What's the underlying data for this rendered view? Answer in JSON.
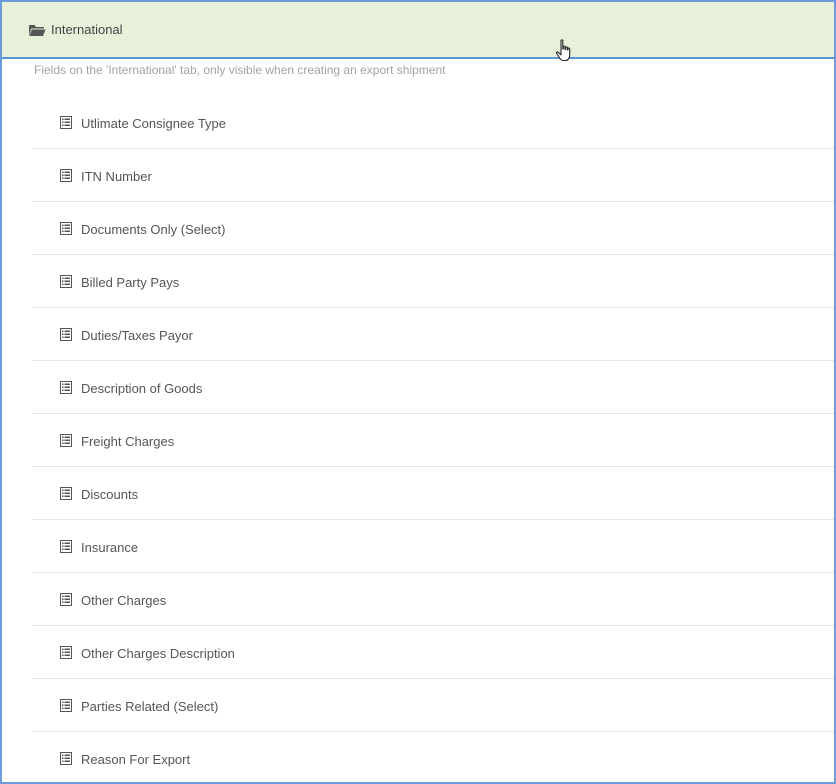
{
  "section": {
    "title": "International",
    "icon": "folder-open-icon",
    "description": "Fields on the 'International' tab, only visible when creating an export shipment",
    "header_color": "#e7f1da",
    "accent_color": "#5b95d6"
  },
  "fields": [
    {
      "label": "Utlimate Consignee Type",
      "icon": "list-icon"
    },
    {
      "label": "ITN Number",
      "icon": "list-icon"
    },
    {
      "label": "Documents Only (Select)",
      "icon": "list-icon"
    },
    {
      "label": "Billed Party Pays",
      "icon": "list-icon"
    },
    {
      "label": "Duties/Taxes Payor",
      "icon": "list-icon"
    },
    {
      "label": "Description of Goods",
      "icon": "list-icon"
    },
    {
      "label": "Freight Charges",
      "icon": "list-icon"
    },
    {
      "label": "Discounts",
      "icon": "list-icon"
    },
    {
      "label": "Insurance",
      "icon": "list-icon"
    },
    {
      "label": "Other Charges",
      "icon": "list-icon"
    },
    {
      "label": "Other Charges Description",
      "icon": "list-icon"
    },
    {
      "label": "Parties Related (Select)",
      "icon": "list-icon"
    },
    {
      "label": "Reason For Export",
      "icon": "list-icon"
    }
  ]
}
